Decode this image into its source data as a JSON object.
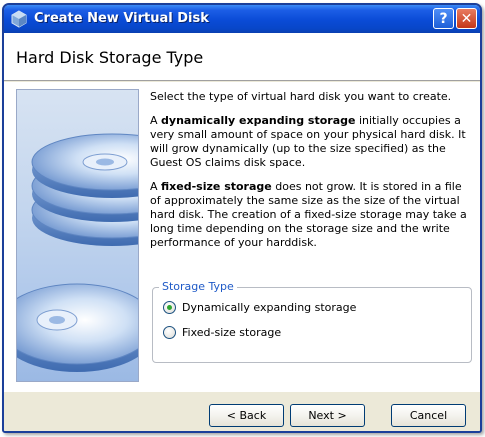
{
  "window": {
    "title": "Create New Virtual Disk",
    "icon": "virtualbox-cube-icon",
    "help_glyph": "?",
    "close_glyph": "✕"
  },
  "header": {
    "title": "Hard Disk Storage Type"
  },
  "description": {
    "intro": "Select the type of virtual hard disk you want to create.",
    "dynamic_bold": "dynamically expanding storage",
    "dynamic_prefix": "A ",
    "dynamic_rest": " initially occupies a very small amount of space on your physical hard disk. It will grow dynamically (up to the size specified) as the Guest OS claims disk space.",
    "fixed_prefix": "A ",
    "fixed_bold": "fixed-size storage",
    "fixed_rest": " does not grow. It is stored in a file of approximately the same size as the size of the virtual hard disk. The creation of a fixed-size storage may take a long time depending on the storage size and the write performance of your harddisk."
  },
  "storage_type": {
    "legend": "Storage Type",
    "options": [
      {
        "label": "Dynamically expanding storage",
        "selected": true
      },
      {
        "label": "Fixed-size storage",
        "selected": false
      }
    ]
  },
  "buttons": {
    "back": "< Back",
    "next": "Next >",
    "cancel": "Cancel"
  },
  "colors": {
    "titlebar": "#0a4bd6",
    "legend": "#1f5ac7",
    "radio_dot": "#2fa52f"
  }
}
